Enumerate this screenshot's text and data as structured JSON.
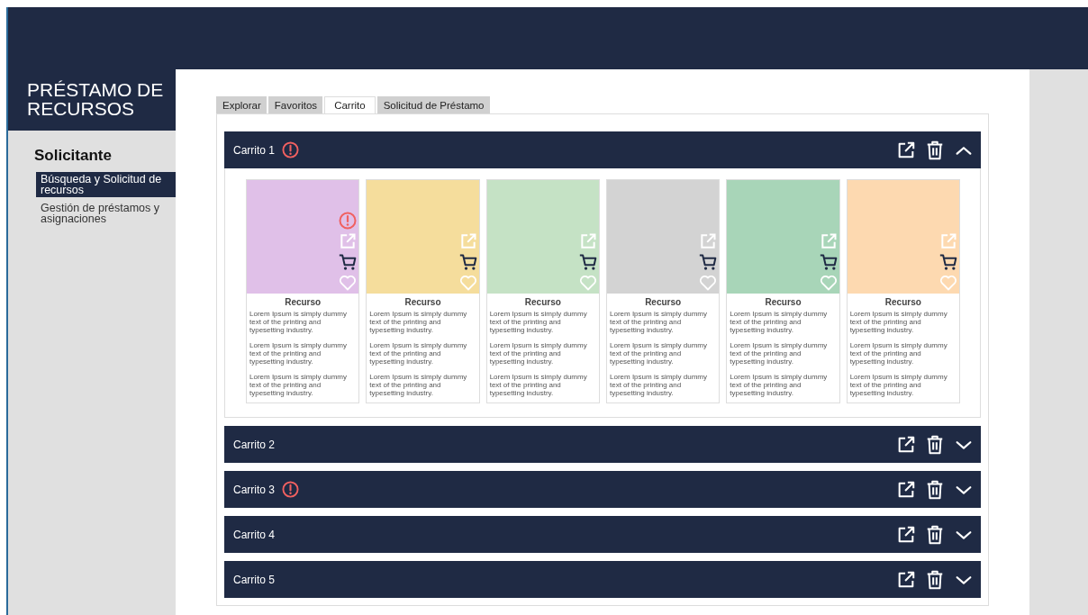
{
  "app": {
    "title": "PRÉSTAMO DE RECURSOS"
  },
  "sidebar": {
    "heading": "Solicitante",
    "items": [
      {
        "label": "Búsqueda y Solicitud de recursos",
        "selected": true
      },
      {
        "label": "Gestión de préstamos y asignaciones",
        "selected": false
      }
    ]
  },
  "tabs": [
    {
      "label": "Explorar",
      "selected": false
    },
    {
      "label": "Favoritos",
      "selected": false
    },
    {
      "label": "Carrito",
      "selected": true
    },
    {
      "label": "Solicitud de Préstamo",
      "selected": false
    }
  ],
  "carts": [
    {
      "label": "Carrito 1",
      "alert": true,
      "expanded": true,
      "resources": [
        {
          "title": "Recurso",
          "color": "#e0c0e8",
          "alert": true,
          "paragraphs": [
            "Lorem Ipsum is simply dummy text of the printing and typesetting industry.",
            "Lorem Ipsum is simply dummy text of the printing and typesetting industry.",
            "Lorem Ipsum is simply dummy text of the printing and typesetting industry."
          ]
        },
        {
          "title": "Recurso",
          "color": "#f5dd9c",
          "alert": false,
          "paragraphs": [
            "Lorem Ipsum is simply dummy text of the printing and typesetting industry.",
            "Lorem Ipsum is simply dummy text of the printing and typesetting industry.",
            "Lorem Ipsum is simply dummy text of the printing and typesetting industry."
          ]
        },
        {
          "title": "Recurso",
          "color": "#c5e2c5",
          "alert": false,
          "paragraphs": [
            "Lorem Ipsum is simply dummy text of the printing and typesetting industry.",
            "Lorem Ipsum is simply dummy text of the printing and typesetting industry.",
            "Lorem Ipsum is simply dummy text of the printing and typesetting industry."
          ]
        },
        {
          "title": "Recurso",
          "color": "#d3d3d3",
          "alert": false,
          "paragraphs": [
            "Lorem Ipsum is simply dummy text of the printing and typesetting industry.",
            "Lorem Ipsum is simply dummy text of the printing and typesetting industry.",
            "Lorem Ipsum is simply dummy text of the printing and typesetting industry."
          ]
        },
        {
          "title": "Recurso",
          "color": "#a8d5b8",
          "alert": false,
          "paragraphs": [
            "Lorem Ipsum is simply dummy text of the printing and typesetting industry.",
            "Lorem Ipsum is simply dummy text of the printing and typesetting industry.",
            "Lorem Ipsum is simply dummy text of the printing and typesetting industry."
          ]
        },
        {
          "title": "Recurso",
          "color": "#fdd9b0",
          "alert": false,
          "paragraphs": [
            "Lorem Ipsum is simply dummy text of the printing and typesetting industry.",
            "Lorem Ipsum is simply dummy text of the printing and typesetting industry.",
            "Lorem Ipsum is simply dummy text of the printing and typesetting industry."
          ]
        }
      ]
    },
    {
      "label": "Carrito 2",
      "alert": false,
      "expanded": false
    },
    {
      "label": "Carrito 3",
      "alert": true,
      "expanded": false
    },
    {
      "label": "Carrito 4",
      "alert": false,
      "expanded": false
    },
    {
      "label": "Carrito 5",
      "alert": false,
      "expanded": false
    }
  ]
}
